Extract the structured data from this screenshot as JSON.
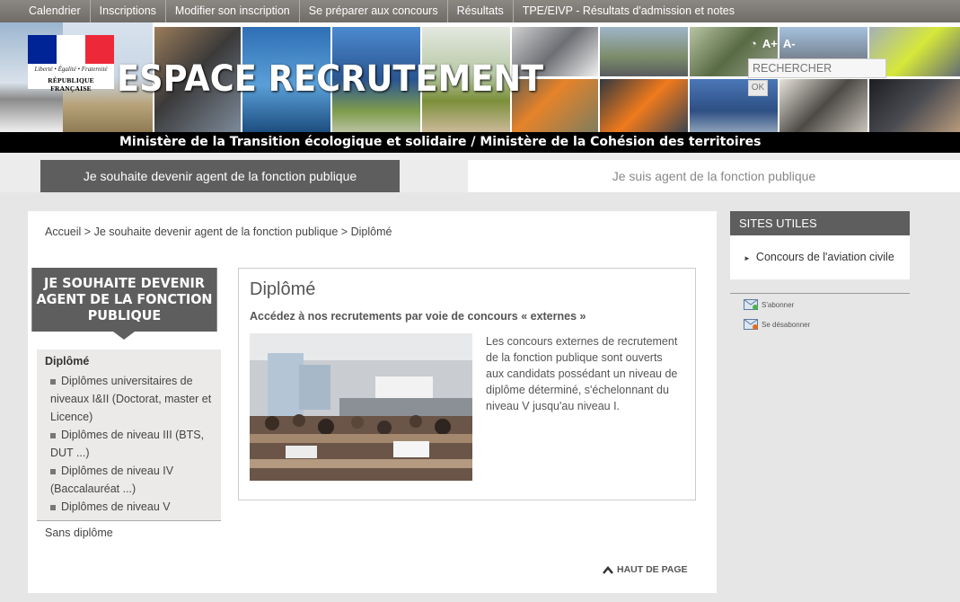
{
  "topnav": [
    "Calendrier",
    "Inscriptions",
    "Modifier son inscription",
    "Se préparer aux concours",
    "Résultats",
    "TPE/EIVP - Résultats d'admission et notes"
  ],
  "logo": {
    "motto": "Liberté • Égalité • Fraternité",
    "name": "RÉPUBLIQUE FRANÇAISE"
  },
  "site_title": "ESPACE RECRUTEMENT",
  "textsize": {
    "increase": "A+",
    "decrease": "A-"
  },
  "search": {
    "placeholder": "RECHERCHER",
    "button": "OK"
  },
  "ministry": "Ministère de la Transition écologique et solidaire / Ministère de la Cohésion des territoires",
  "tabs": {
    "active": "Je souhaite devenir agent de la fonction publique",
    "inactive": "Je suis agent de la fonction publique"
  },
  "breadcrumb": {
    "home": "Accueil",
    "sep": ">",
    "parent": "Je souhaite devenir agent de la fonction publique",
    "current": "Diplômé"
  },
  "sidebar": {
    "heading": "JE SOUHAITE DEVENIR AGENT DE LA FONCTION PUBLIQUE",
    "active": "Diplômé",
    "items": [
      "Diplômes universitaires de niveaux I&II (Doctorat, master et Licence)",
      "Diplômes de niveau III (BTS, DUT ...)",
      "Diplômes de niveau IV (Baccalauréat ...)",
      "Diplômes de niveau V"
    ],
    "other": "Sans diplôme"
  },
  "article": {
    "title": "Diplômé",
    "subtitle": "Accédez à nos recrutements par voie de concours « externes »",
    "body": "Les concours externes de recrutement de la fonction publique sont ouverts aux candidats possédant un niveau de diplôme déterminé, s'échelonnant du niveau V jusqu'au niveau I."
  },
  "back_to_top": "HAUT DE PAGE",
  "useful_sites": {
    "heading": "SITES UTILES",
    "link": "Concours de l'aviation civile"
  },
  "subscribe": {
    "on": "S'abonner",
    "off": "Se désabonner"
  },
  "colors": {
    "nav": "#7d7a75",
    "panel": "#5e5e5e",
    "flag_blue": "#002395",
    "flag_red": "#ed2939"
  }
}
